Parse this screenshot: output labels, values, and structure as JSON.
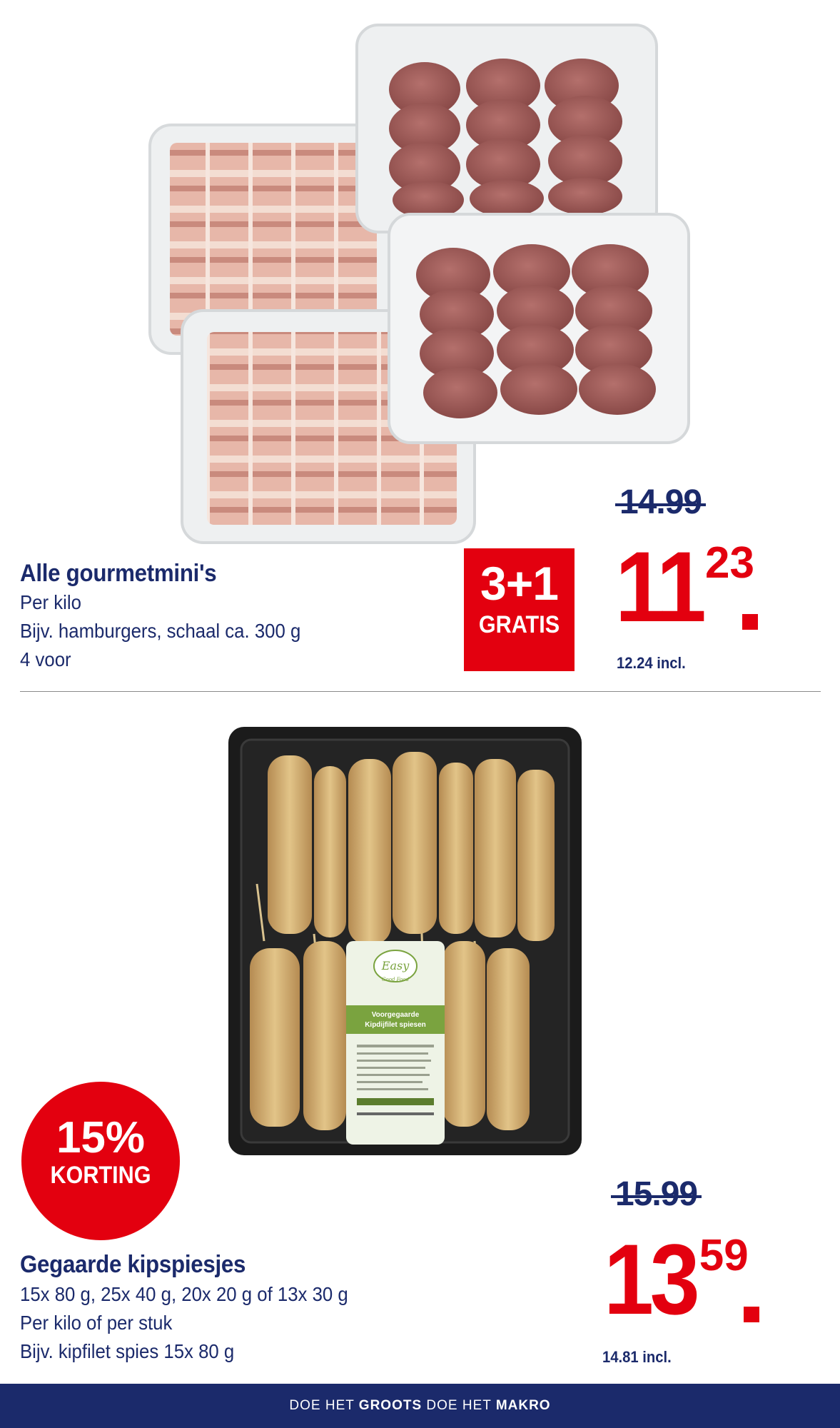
{
  "product1": {
    "title": "Alle gourmetmini's",
    "lines": [
      "Per kilo",
      "Bijv. hamburgers, schaal ca. 300 g",
      "4 voor"
    ],
    "badge": {
      "big": "3+1",
      "small": "GRATIS"
    },
    "old_price": "14.99",
    "price_int": "11",
    "price_dec": "23",
    "incl": "12.24 incl."
  },
  "product2": {
    "title": "Gegaarde kipspiesjes",
    "lines": [
      "15x 80 g, 25x 40 g, 20x 20 g of 13x 30 g",
      "Per kilo of per stuk",
      "Bijv. kipfilet spies 15x 80 g"
    ],
    "badge": {
      "big": "15%",
      "small": "KORTING"
    },
    "old_price": "15.99",
    "price_int": "13",
    "price_dec": "59",
    "incl": "14.81 incl.",
    "package": {
      "brand": "Easy",
      "brand_sub": "Good Food",
      "name_1": "Voorgegaarde",
      "name_2": "Kipdijfilet spiesen"
    }
  },
  "footer": {
    "part1": "DOE HET",
    "part2": "GROOTS",
    "part3": "DOE HET",
    "part4": "MAKRO"
  },
  "colors": {
    "brand_blue": "#1b2a6b",
    "promo_red": "#e3000f"
  },
  "images": {
    "product1": "meat-trays-photo",
    "product2": "chicken-skewers-tray-photo"
  }
}
